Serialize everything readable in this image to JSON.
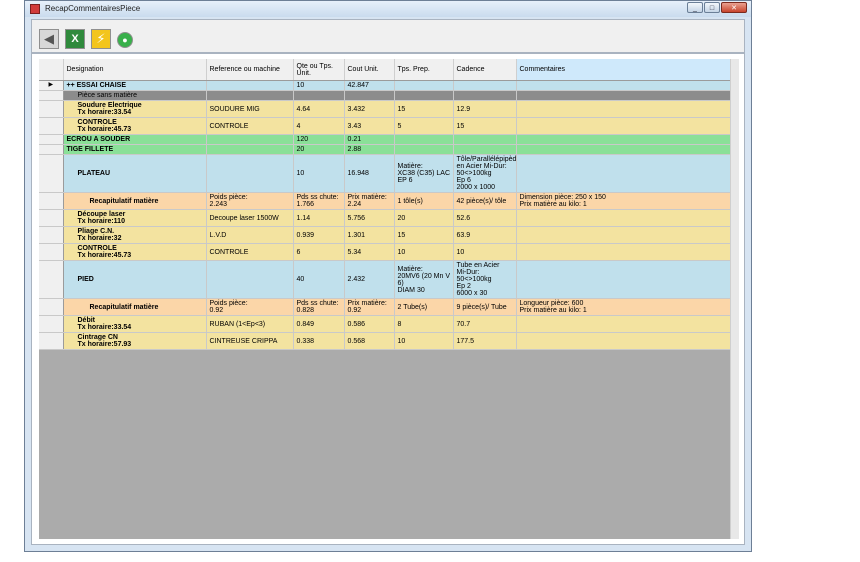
{
  "window": {
    "title": "RecapCommentairesPiece",
    "controls": {
      "minimize": "_",
      "maximize": "□",
      "close": "✕"
    }
  },
  "toolbar": {
    "icons": [
      "back-arrow-icon",
      "excel-icon",
      "flash-icon",
      "refresh-icon"
    ],
    "back_glyph": "◀",
    "excel_glyph": "X",
    "flash_glyph": "⚡",
    "refresh_glyph": "●"
  },
  "table": {
    "columns": [
      "Designation",
      "Reference ou machine",
      "Qte ou Tps. Unit.",
      "Cout Unit.",
      "Tps. Prep.",
      "Cadence",
      "Commentaires"
    ],
    "row_marker": "▶",
    "rows": [
      {
        "style": "blue",
        "cells": [
          "++ ESSAI CHAISE",
          "",
          "10",
          "42.847",
          "",
          "",
          ""
        ]
      },
      {
        "style": "gray",
        "cells": [
          "Pièce sans matière",
          "",
          "",
          "",
          "",
          "",
          ""
        ]
      },
      {
        "style": "yellow",
        "cells": [
          "Soudure Electrique\nTx horaire:33.54",
          "SOUDURE MIG",
          "4.64",
          "3.432",
          "15",
          "12.9",
          ""
        ]
      },
      {
        "style": "yellow",
        "cells": [
          "CONTROLE\nTx horaire:45.73",
          "CONTROLE",
          "4",
          "3.43",
          "5",
          "15",
          ""
        ]
      },
      {
        "style": "green",
        "cells": [
          "ECROU A SOUDER",
          "",
          "120",
          "0.21",
          "",
          "",
          ""
        ]
      },
      {
        "style": "green",
        "cells": [
          "TIGE FILLETE",
          "",
          "20",
          "2.88",
          "",
          "",
          ""
        ]
      },
      {
        "style": "blue",
        "cells": [
          "PLATEAU",
          "",
          "10",
          "16.948",
          "Matière:\nXC38 (C35) LAC\nEP 6",
          "Tôle/Parallélépipède\nen Acier Mi-Dur:\n50<>100kg\nEp 6\n2000 x 1000",
          ""
        ]
      },
      {
        "style": "peach",
        "cells": [
          "Recapitulatif matière",
          "Poids pièce:\n2.243",
          "Pds ss chute:\n1.766",
          "Prix matière:\n2.24",
          "1 tôle(s)",
          "42 pièce(s)/ tôle",
          "Dimension pièce: 250 x 150\nPrix matière au kilo: 1"
        ]
      },
      {
        "style": "yellow",
        "cells": [
          "Découpe laser\nTx horaire:110",
          "Decoupe laser 1500W",
          "1.14",
          "5.756",
          "20",
          "52.6",
          ""
        ]
      },
      {
        "style": "yellow",
        "cells": [
          "Pliage C.N.\nTx horaire:32",
          "L.V.D",
          "0.939",
          "1.301",
          "15",
          "63.9",
          ""
        ]
      },
      {
        "style": "yellow",
        "cells": [
          "CONTROLE\nTx horaire:45.73",
          "CONTROLE",
          "6",
          "5.34",
          "10",
          "10",
          ""
        ]
      },
      {
        "style": "blue",
        "cells": [
          "PIED",
          "",
          "40",
          "2.432",
          "Matière:\n20MV6 (20 Mn V 6)\nDIAM 30",
          "Tube en Acier\nMi-Dur: 50<>100kg\nEp 2\n6000 x 30",
          ""
        ]
      },
      {
        "style": "peach",
        "cells": [
          "Recapitulatif matière",
          "Poids pièce:\n0.92",
          "Pds ss chute:\n0.828",
          "Prix matière:\n0.92",
          "2 Tube(s)",
          "9 pièce(s)/ Tube",
          "Longueur pièce: 600\nPrix matière au kilo: 1"
        ]
      },
      {
        "style": "yellow",
        "cells": [
          "Débit\nTx horaire:33.54",
          "RUBAN (1<Ep<3)",
          "0.849",
          "0.586",
          "8",
          "70.7",
          ""
        ]
      },
      {
        "style": "yellow",
        "cells": [
          "Cintrage CN\nTx horaire:57.93",
          "CINTREUSE CRIPPA",
          "0.338",
          "0.568",
          "10",
          "177.5",
          ""
        ]
      }
    ]
  }
}
